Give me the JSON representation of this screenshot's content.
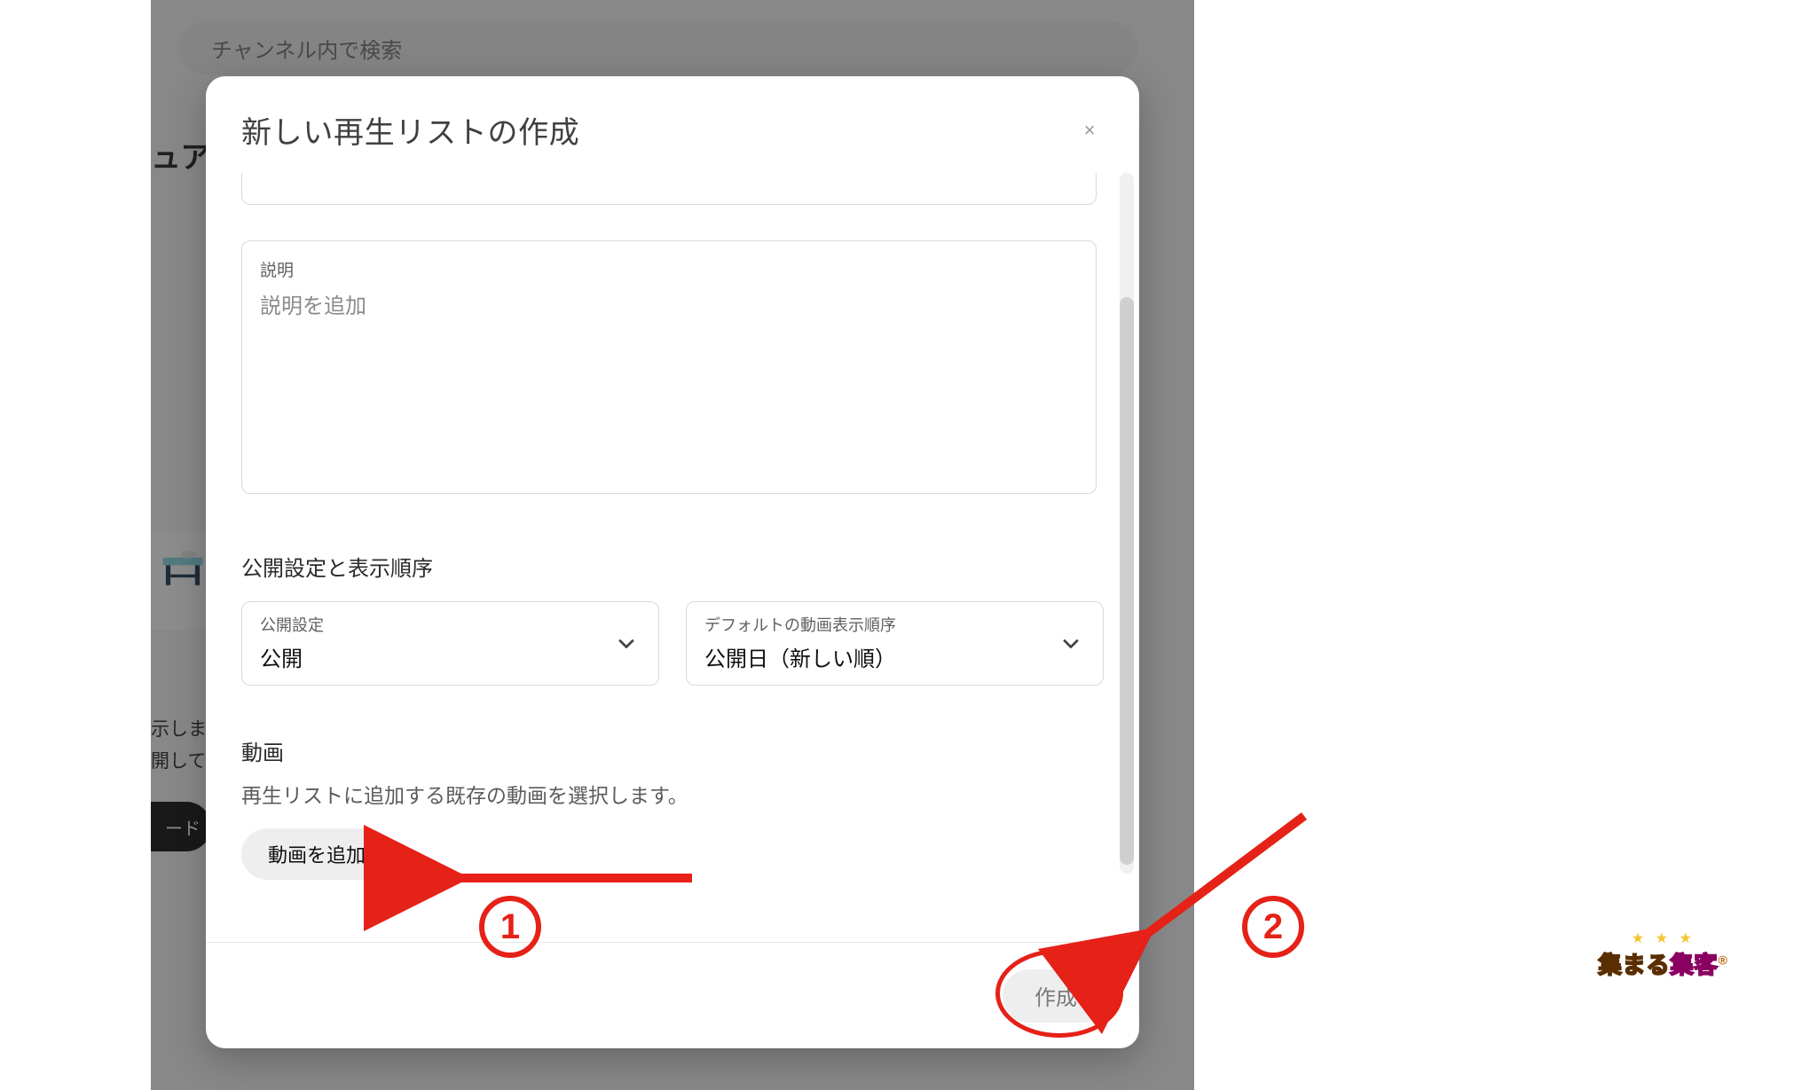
{
  "background": {
    "search_placeholder": "チャンネル内で検索",
    "heading_fragment": "ュア",
    "line1": "示しま",
    "line2": "開して",
    "button_fragment": "ード"
  },
  "dialog": {
    "title": "新しい再生リストの作成",
    "close_label": "×",
    "description": {
      "label": "説明",
      "placeholder": "説明を追加"
    },
    "visibility_section_heading": "公開設定と表示順序",
    "visibility_select": {
      "label": "公開設定",
      "value": "公開"
    },
    "order_select": {
      "label": "デフォルトの動画表示順序",
      "value": "公開日（新しい順）"
    },
    "videos_section": {
      "heading": "動画",
      "helper": "再生リストに追加する既存の動画を選択します。",
      "add_button": "動画を追加"
    },
    "create_button": "作成"
  },
  "annotations": {
    "step1": "1",
    "step2": "2"
  },
  "brand": {
    "left": "集まる",
    "right": "集客",
    "reg": "®"
  }
}
